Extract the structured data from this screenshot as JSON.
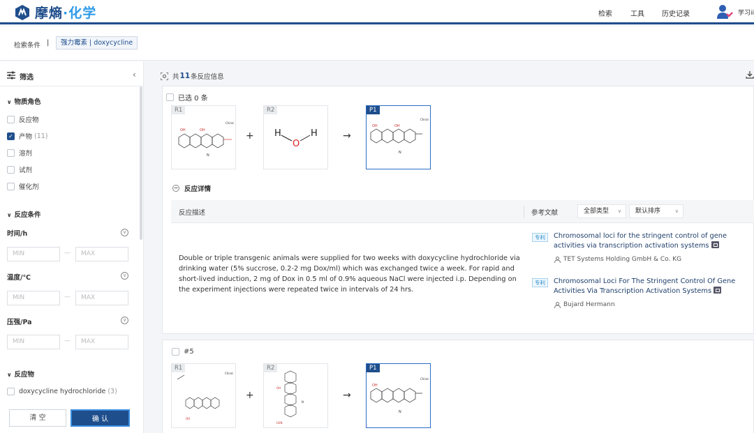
{
  "header": {
    "brand_main": "摩熵",
    "brand_dot": "·",
    "brand_sub": "化学",
    "nav": [
      "检索",
      "工具",
      "历史记录"
    ],
    "user_name": "学习ii"
  },
  "breadcrumb": {
    "label": "检索条件",
    "separator": "|",
    "tag": "强力霉素 | doxycycline"
  },
  "sidebar": {
    "title": "筛选",
    "material_role": {
      "title": "物质角色",
      "options": [
        {
          "label": "反应物",
          "count": "",
          "checked": false
        },
        {
          "label": "产物",
          "count": "(11)",
          "checked": true
        },
        {
          "label": "溶剂",
          "count": "",
          "checked": false
        },
        {
          "label": "试剂",
          "count": "",
          "checked": false
        },
        {
          "label": "催化剂",
          "count": "",
          "checked": false
        }
      ]
    },
    "conditions": {
      "title": "反应条件",
      "items": [
        {
          "label": "时间/h",
          "min": "MIN",
          "max": "MAX"
        },
        {
          "label": "温度/℃",
          "min": "MIN",
          "max": "MAX"
        },
        {
          "label": "压强/Pa",
          "min": "MIN",
          "max": "MAX"
        }
      ]
    },
    "reactants": {
      "title": "反应物",
      "options": [
        {
          "label": "doxycycline hydrochloride",
          "count": "(3)"
        }
      ]
    },
    "clear_label": "清 空",
    "confirm_label": "确 认"
  },
  "results": {
    "prefix": "共",
    "count": "11",
    "suffix": "条反应信息",
    "selected": "已选 0 条"
  },
  "reaction1": {
    "tags": [
      "R1",
      "R2",
      "P1"
    ],
    "plus": "+",
    "arrow": "→",
    "water_atoms": [
      "H",
      "O",
      "H"
    ],
    "chiral_label": "Chiral",
    "detail_toggle": "反应详情",
    "col_desc": "反应描述",
    "col_ref": "参考文献",
    "filter_type": "全部类型",
    "filter_sort": "默认排序",
    "description": "Double or triple transgenic animals were supplied for two weeks with doxycycline hydrochloride via drinking water (5% succrose, 0.2-2 mg Dox/ml) which was exchanged twice a week. For rapid and short-lived induction, 2 mg of Dox in 0.5 ml of 0.9% aqueous NaCl were injected i.p. Depending on the experiment injections were repeated twice in intervals of 24 hrs.",
    "references": [
      {
        "badge": "专利",
        "title": "Chromosomal loci for the stringent control of gene activities via transcription activation systems",
        "author": "TET Systems Holding GmbH & Co. KG"
      },
      {
        "badge": "专利",
        "title": "Chromosomal Loci For The Stringent Control Of Gene Activities Via Transcription Activation Systems",
        "author": "Bujard Hermann"
      }
    ]
  },
  "reaction2": {
    "number": "#5",
    "tags": [
      "R1",
      "R2",
      "P1"
    ],
    "plus": "+",
    "arrow": "→"
  },
  "colors": {
    "brand": "#1f4e8c",
    "accent": "#2f9be8",
    "patent": "#2f8ccc"
  }
}
